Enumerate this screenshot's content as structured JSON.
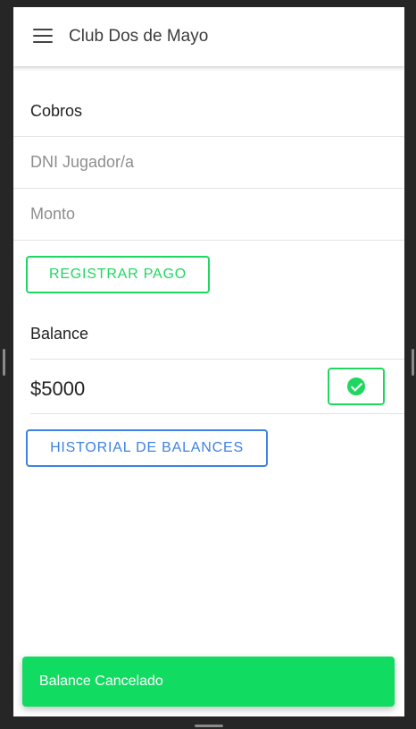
{
  "app": {
    "title": "Club Dos de Mayo"
  },
  "cobros": {
    "title": "Cobros",
    "dni_placeholder": "DNI Jugador/a",
    "dni_value": "",
    "monto_placeholder": "Monto",
    "monto_value": "",
    "register_label": "REGISTRAR PAGO"
  },
  "balance": {
    "title": "Balance",
    "amount": "$5000",
    "history_label": "HISTORIAL DE BALANCES"
  },
  "toast": {
    "message": "Balance Cancelado"
  },
  "icons": {
    "menu": "hamburger-menu-icon",
    "confirm": "check-circle-icon"
  },
  "colors": {
    "accent_green": "#1fd760",
    "accent_blue": "#3e82e3",
    "toast_bg": "#12db62"
  }
}
